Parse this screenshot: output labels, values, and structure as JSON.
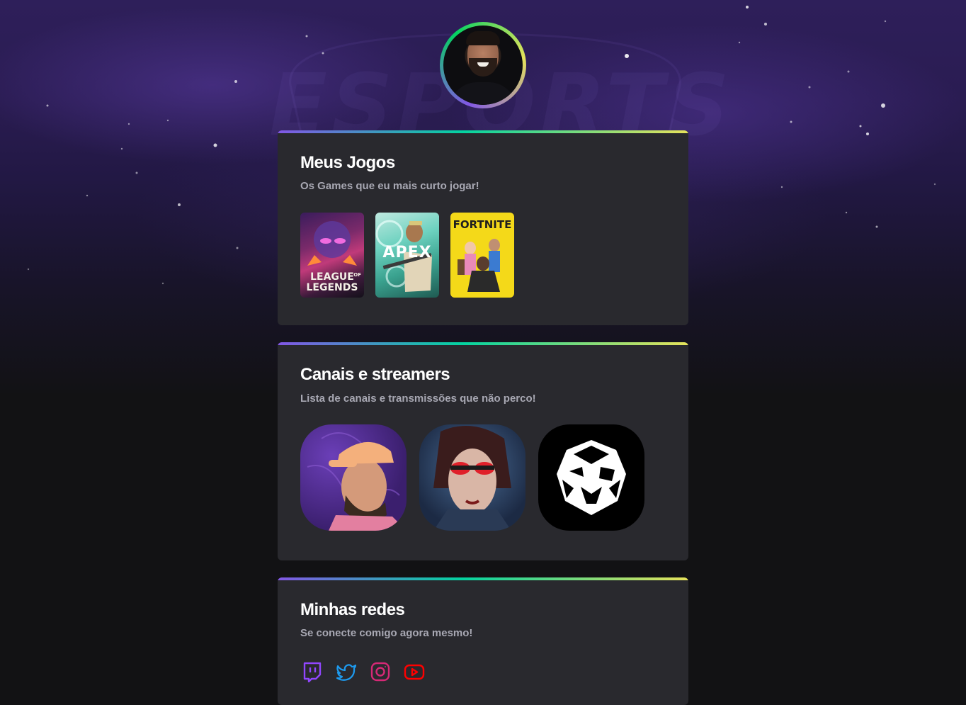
{
  "profile": {
    "avatar_alt": "Avatar"
  },
  "background": {
    "watermark_text": "ESPORTS"
  },
  "colors": {
    "accent_purple": "#8257e5",
    "accent_green": "#04d3a0",
    "accent_yellow": "#e6e35b",
    "card_bg": "#29292e",
    "page_bg": "#121214"
  },
  "games": {
    "title": "Meus Jogos",
    "subtitle": "Os Games que eu mais curto jogar!",
    "items": [
      {
        "name": "League of Legends",
        "label_line1": "LEAGUE",
        "label_small": "OF",
        "label_line2": "LEGENDS"
      },
      {
        "name": "Apex Legends",
        "label": "APEX"
      },
      {
        "name": "Fortnite",
        "label": "FORTNITE"
      }
    ]
  },
  "streamers": {
    "title": "Canais e streamers",
    "subtitle": "Lista de canais e transmissões que não perco!",
    "items": [
      {
        "name": "streamer-1"
      },
      {
        "name": "streamer-2"
      },
      {
        "name": "streamer-3"
      }
    ]
  },
  "socials": {
    "title": "Minhas redes",
    "subtitle": "Se conecte comigo agora mesmo!",
    "items": [
      {
        "icon": "twitch-icon",
        "color": "#9146ff"
      },
      {
        "icon": "twitter-icon",
        "color": "#1d9bf0"
      },
      {
        "icon": "instagram-icon",
        "color": "#d62976"
      },
      {
        "icon": "youtube-icon",
        "color": "#ff0000"
      }
    ]
  }
}
